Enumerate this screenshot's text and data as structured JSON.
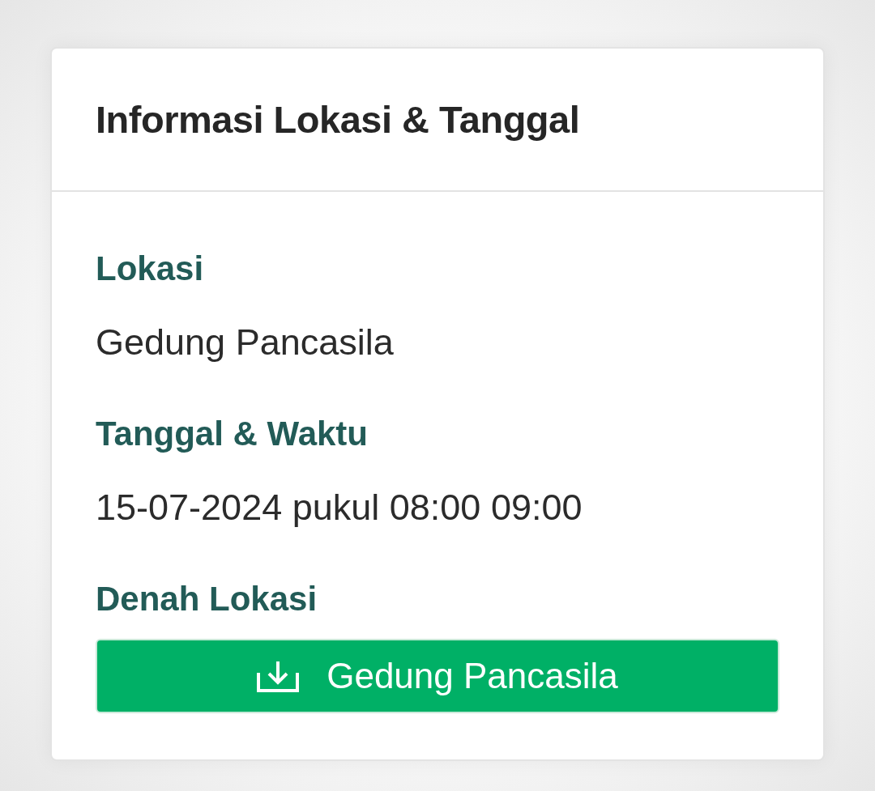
{
  "card": {
    "title": "Informasi Lokasi & Tanggal",
    "sections": [
      {
        "kind": "text",
        "heading": "Lokasi",
        "value": "Gedung Pancasila"
      },
      {
        "kind": "text",
        "heading": "Tanggal & Waktu",
        "value": "15-07-2024 pukul 08:00 09:00"
      },
      {
        "kind": "download",
        "heading": "Denah Lokasi",
        "button": {
          "label": "Gedung Pancasila"
        }
      }
    ]
  }
}
